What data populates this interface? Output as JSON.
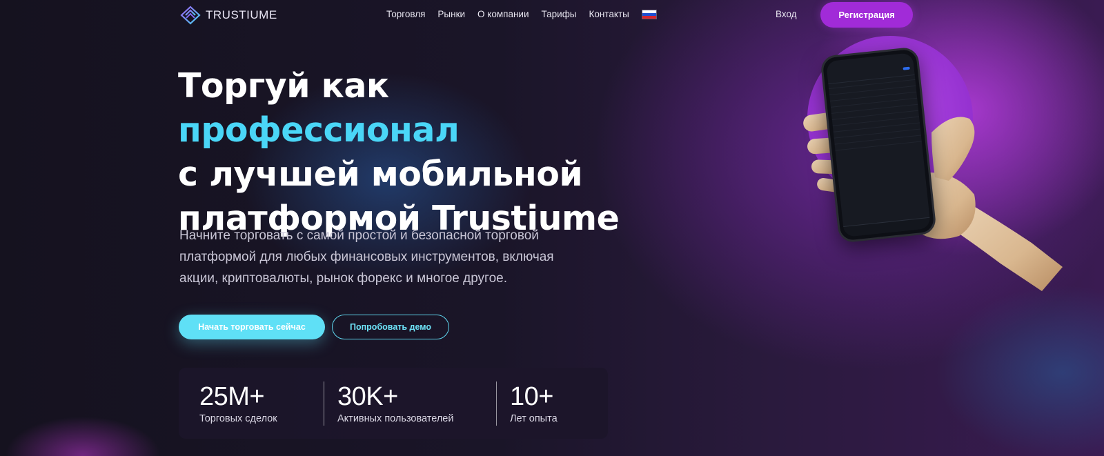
{
  "brand": {
    "name": "TRUSTIUME"
  },
  "nav": {
    "links": [
      "Торговля",
      "Рынки",
      "О компании",
      "Тарифы",
      "Контакты"
    ],
    "language_flag": "flag-ru-icon",
    "login_label": "Вход",
    "register_label": "Регистрация"
  },
  "hero": {
    "title_part1": "Торгуй как ",
    "title_accent": "профессионал",
    "title_line2": "с лучшей мобильной",
    "title_line3": "платформой Trustiume",
    "subtitle": "Начните торговать с самой простой и безопасной торговой платформой для любых финансовых инструментов, включая акции, криптовалюты, рынок форекс и многое другое.",
    "primary_cta": "Начать торговать сейчас",
    "secondary_cta": "Попробовать демо"
  },
  "stats": [
    {
      "value": "25M+",
      "label": "Торговых сделок"
    },
    {
      "value": "30K+",
      "label": "Активных пользователей"
    },
    {
      "value": "10+",
      "label": "Лет опыта"
    }
  ],
  "colors": {
    "accent_cyan": "#4ad6f7",
    "brand_purple": "#a12bd8",
    "background": "#15121f"
  }
}
